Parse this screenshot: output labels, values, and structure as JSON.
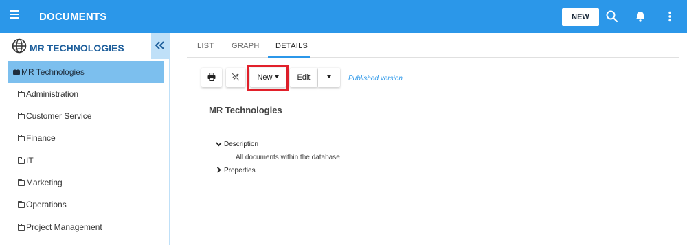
{
  "header": {
    "title": "DOCUMENTS",
    "new_label": "NEW",
    "icons": [
      "menu-icon",
      "search-icon",
      "bell-icon",
      "kebab-icon"
    ]
  },
  "sidebar": {
    "org_title": "MR TECHNOLOGIES",
    "root": {
      "label": "MR Technologies",
      "toggle": "–"
    },
    "items": [
      {
        "label": "Administration"
      },
      {
        "label": "Customer Service"
      },
      {
        "label": "Finance"
      },
      {
        "label": "IT"
      },
      {
        "label": "Marketing"
      },
      {
        "label": "Operations"
      },
      {
        "label": "Project Management"
      }
    ]
  },
  "main": {
    "tabs": [
      {
        "label": "LIST"
      },
      {
        "label": "GRAPH"
      },
      {
        "label": "DETAILS",
        "active": true
      }
    ],
    "toolbar": {
      "new_label": "New",
      "edit_label": "Edit",
      "status_text": "Published version"
    },
    "document": {
      "title": "MR Technologies",
      "description_label": "Description",
      "description_text": "All documents within the database",
      "properties_label": "Properties"
    }
  },
  "colors": {
    "topbar": "#2b97e9",
    "sidebar_selected": "#7cbfee",
    "sidebar_panel": "#bfe0f8",
    "highlight": "#e2202b",
    "accent_text": "#1d5e9b"
  }
}
